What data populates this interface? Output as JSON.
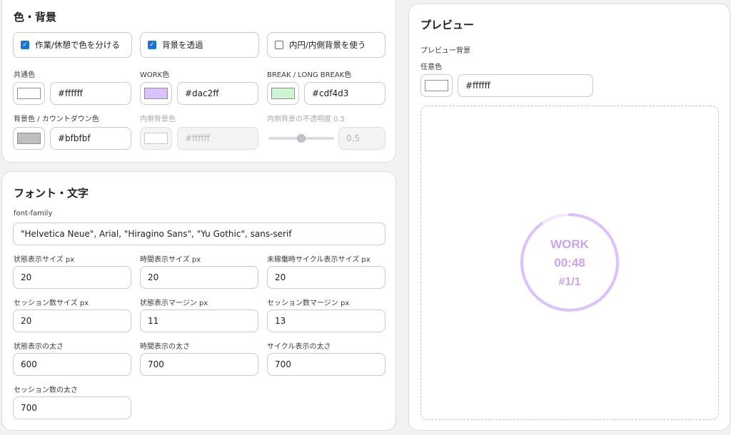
{
  "colors_section": {
    "title": "色・背景",
    "checks": [
      {
        "label": "作業/休憩で色を分ける",
        "checked": true
      },
      {
        "label": "背景を透過",
        "checked": true
      },
      {
        "label": "内円/内側背景を使う",
        "checked": false
      }
    ],
    "common_color": {
      "label": "共通色",
      "value": "#ffffff",
      "swatch": "#ffffff"
    },
    "work_color": {
      "label": "WORK色",
      "value": "#dac2ff",
      "swatch": "#dac2ff"
    },
    "break_color": {
      "label": "BREAK / LONG BREAK色",
      "value": "#cdf4d3",
      "swatch": "#cdf4d3"
    },
    "bg_color": {
      "label": "背景色 / カウントダウン色",
      "value": "#bfbfbf",
      "swatch": "#bfbfbf"
    },
    "inner_bg": {
      "label": "内側背景色",
      "placeholder": "#ffffff",
      "swatch": "#ffffff",
      "disabled": true
    },
    "inner_opacity": {
      "label": "内側背景の不透明度 0.5",
      "value": "0.5",
      "level": 0.5,
      "disabled": true
    }
  },
  "fonts_section": {
    "title": "フォント・文字",
    "font_family_label": "font-family",
    "font_family_value": "\"Helvetica Neue\", Arial, \"Hiragino Sans\", \"Yu Gothic\", sans-serif",
    "fields": [
      {
        "label": "状態表示サイズ px",
        "value": "20"
      },
      {
        "label": "時間表示サイズ px",
        "value": "20"
      },
      {
        "label": "未稼働時サイクル表示サイズ px",
        "value": "20"
      },
      {
        "label": "セッション数サイズ px",
        "value": "20"
      },
      {
        "label": "状態表示マージン px",
        "value": "11"
      },
      {
        "label": "セッション数マージン px",
        "value": "13"
      },
      {
        "label": "状態表示の太さ",
        "value": "600"
      },
      {
        "label": "時間表示の太さ",
        "value": "700"
      },
      {
        "label": "サイクル表示の太さ",
        "value": "700"
      },
      {
        "label": "セッション数の太さ",
        "value": "700"
      }
    ]
  },
  "preview_section": {
    "title": "プレビュー",
    "bg_label": "プレビュー背景",
    "any_color_label": "任意色",
    "any_color_value": "#ffffff",
    "any_color_swatch": "#ffffff",
    "timer": {
      "state": "WORK",
      "time": "00:48",
      "session": "#1/1",
      "ring_color": "#dac2ff",
      "track_color": "#f1e8ff",
      "progress": 0.9
    }
  }
}
